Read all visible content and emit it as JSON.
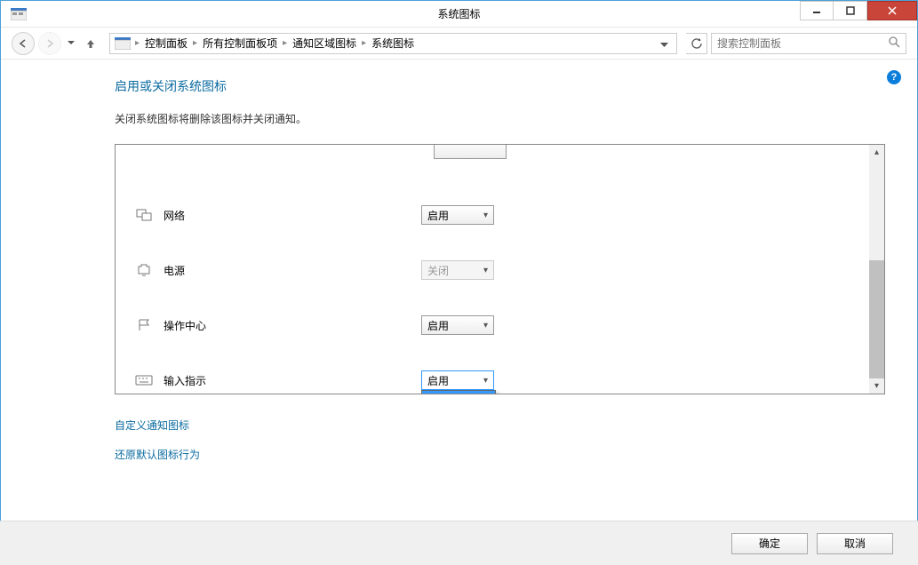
{
  "window": {
    "title": "系统图标"
  },
  "nav": {
    "breadcrumb": [
      "控制面板",
      "所有控制面板项",
      "通知区域图标",
      "系统图标"
    ],
    "search_placeholder": "搜索控制面板"
  },
  "page": {
    "title": "启用或关闭系统图标",
    "description": "关闭系统图标将删除该图标并关闭通知。"
  },
  "rows": [
    {
      "icon": "network-icon",
      "label": "网络",
      "value": "启用",
      "disabled": false,
      "open": false
    },
    {
      "icon": "power-icon",
      "label": "电源",
      "value": "关闭",
      "disabled": true,
      "open": false
    },
    {
      "icon": "flag-icon",
      "label": "操作中心",
      "value": "启用",
      "disabled": false,
      "open": false
    },
    {
      "icon": "keyboard-icon",
      "label": "输入指示",
      "value": "启用",
      "disabled": false,
      "open": true
    }
  ],
  "options": {
    "enable": "启用",
    "disable": "关闭"
  },
  "links": {
    "customize": "自定义通知图标",
    "restore": "还原默认图标行为"
  },
  "buttons": {
    "ok": "确定",
    "cancel": "取消"
  }
}
